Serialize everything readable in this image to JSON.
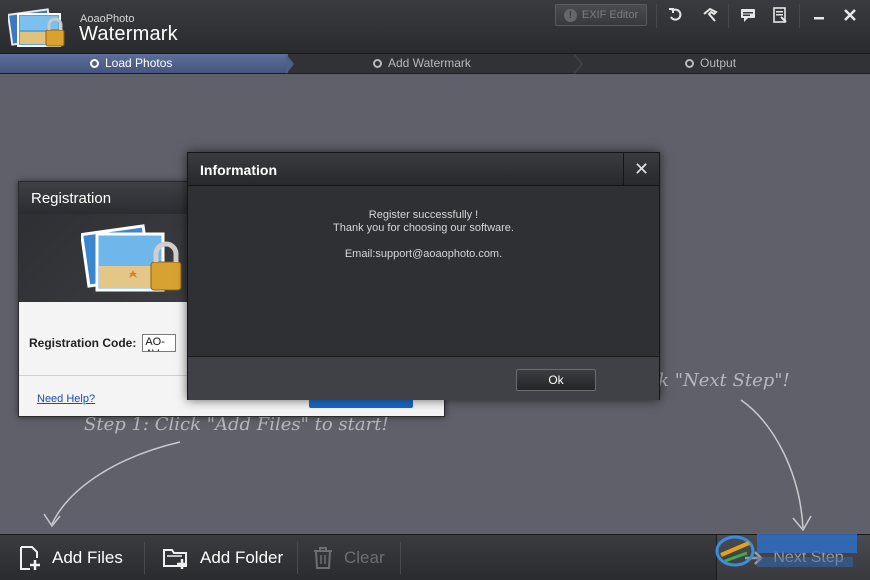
{
  "app": {
    "brand_small": "AoaoPhoto",
    "brand_big": "Watermark"
  },
  "titlebar": {
    "exif_label": "EXIF Editor",
    "icons": [
      "undo-icon",
      "hammer-icon",
      "chat-icon",
      "register-icon",
      "minimize-icon",
      "close-icon"
    ]
  },
  "steps": [
    {
      "label": "Load Photos",
      "active": true
    },
    {
      "label": "Add Watermark",
      "active": false
    },
    {
      "label": "Output",
      "active": false
    }
  ],
  "hints": {
    "step1": "Step 1: Click \"Add Files\" to start!",
    "step3": "ck \"Next Step\"!"
  },
  "registration": {
    "title": "Registration",
    "code_label": "Registration Code:",
    "code_value": "AO-AV",
    "help_link": "Need Help?"
  },
  "info_dialog": {
    "title": "Information",
    "line1": "Register successfully !",
    "line2": "Thank you for choosing our software.",
    "email": "Email:support@aoaophoto.com.",
    "ok_label": "Ok"
  },
  "bottombar": {
    "add_files": "Add Files",
    "add_folder": "Add Folder",
    "clear": "Clear",
    "next_step": "Next Step"
  },
  "colors": {
    "accent_step": "#5466a0",
    "main_bg": "#5f6069",
    "link": "#1b49b5"
  }
}
